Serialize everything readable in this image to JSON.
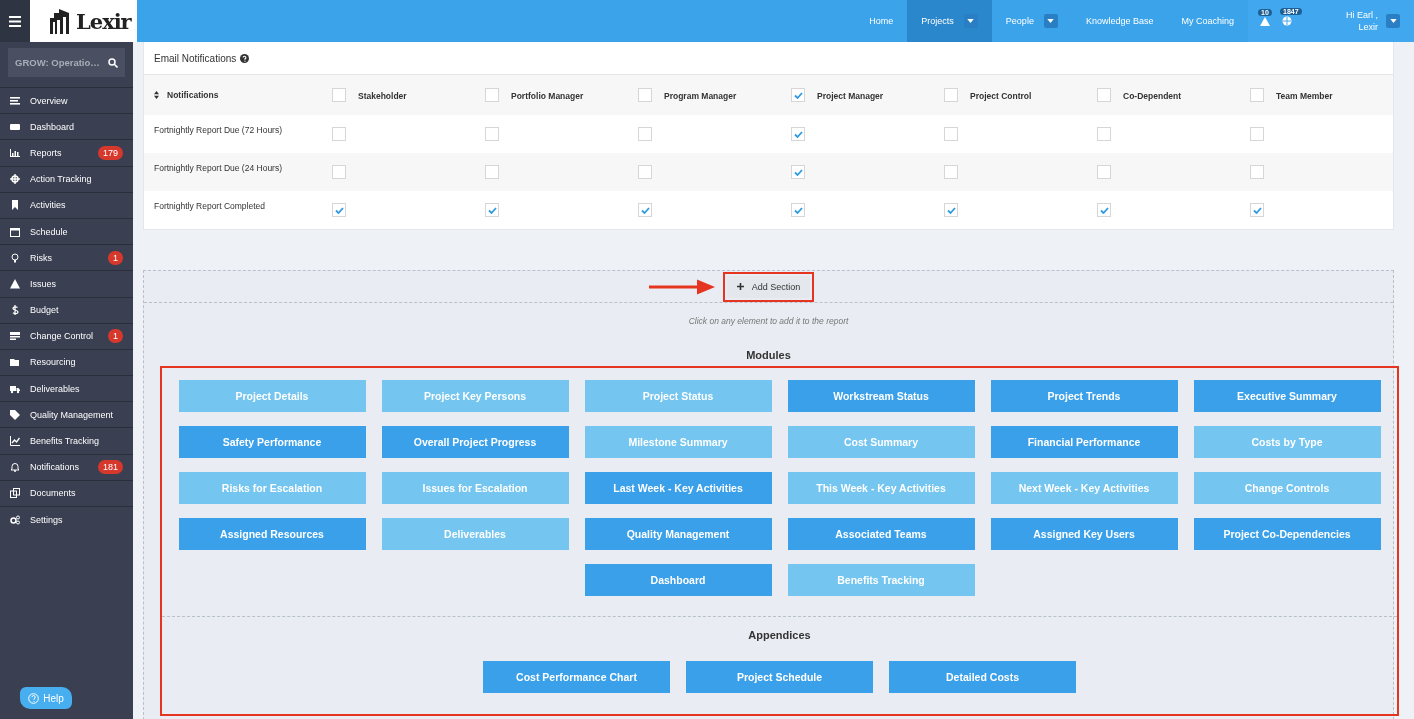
{
  "topbar": {
    "logo": "Lexir",
    "nav": [
      {
        "label": "Home",
        "selected": false,
        "dropdown": false
      },
      {
        "label": "Projects",
        "selected": true,
        "dropdown": true
      },
      {
        "label": "People",
        "selected": false,
        "dropdown": true
      },
      {
        "label": "Knowledge Base",
        "selected": false,
        "dropdown": false
      },
      {
        "label": "My Coaching",
        "selected": false,
        "dropdown": false
      }
    ],
    "alerts": [
      {
        "kind": "warning",
        "count": "10"
      },
      {
        "kind": "globe",
        "count": "1847"
      }
    ],
    "user": {
      "greeting": "Hi Earl ,",
      "name": "Lexir"
    }
  },
  "sidebar": {
    "project_search": {
      "value": "GROW: Operatio…"
    },
    "items": [
      {
        "label": "Overview"
      },
      {
        "label": "Dashboard"
      },
      {
        "label": "Reports",
        "badge": "179"
      },
      {
        "label": "Action Tracking"
      },
      {
        "label": "Activities"
      },
      {
        "label": "Schedule"
      },
      {
        "label": "Risks",
        "badge": "1"
      },
      {
        "label": "Issues"
      },
      {
        "label": "Budget"
      },
      {
        "label": "Change Control",
        "badge": "1"
      },
      {
        "label": "Resourcing"
      },
      {
        "label": "Deliverables"
      },
      {
        "label": "Quality Management"
      },
      {
        "label": "Benefits Tracking"
      },
      {
        "label": "Notifications",
        "badge": "181"
      },
      {
        "label": "Documents"
      },
      {
        "label": "Settings"
      }
    ],
    "help": "Help"
  },
  "email_notifications": {
    "title": "Email Notifications",
    "first_column": "Notifications",
    "columns": [
      {
        "label": "Stakeholder",
        "checked": false
      },
      {
        "label": "Portfolio Manager",
        "checked": false
      },
      {
        "label": "Program Manager",
        "checked": false
      },
      {
        "label": "Project Manager",
        "checked": true
      },
      {
        "label": "Project Control",
        "checked": false
      },
      {
        "label": "Co-Dependent",
        "checked": false
      },
      {
        "label": "Team Member",
        "checked": false
      }
    ],
    "rows": [
      {
        "label": "Fortnightly Report Due (72 Hours)",
        "checks": [
          false,
          false,
          false,
          true,
          false,
          false,
          false
        ]
      },
      {
        "label": "Fortnightly Report Due (24 Hours)",
        "checks": [
          false,
          false,
          false,
          true,
          false,
          false,
          false
        ]
      },
      {
        "label": "Fortnightly Report Completed",
        "checks": [
          true,
          true,
          true,
          true,
          true,
          true,
          true
        ]
      }
    ]
  },
  "report_builder": {
    "add_section": "Add Section",
    "hint": "Click on any element to add it to the report",
    "modules": {
      "title": "Modules",
      "items": [
        {
          "label": "Project Details",
          "added": true
        },
        {
          "label": "Project Key Persons",
          "added": true
        },
        {
          "label": "Project Status",
          "added": true
        },
        {
          "label": "Workstream Status",
          "added": false
        },
        {
          "label": "Project Trends",
          "added": false
        },
        {
          "label": "Executive Summary",
          "added": false
        },
        {
          "label": "Safety Performance",
          "added": false
        },
        {
          "label": "Overall Project Progress",
          "added": false
        },
        {
          "label": "Milestone Summary",
          "added": true
        },
        {
          "label": "Cost Summary",
          "added": true
        },
        {
          "label": "Financial Performance",
          "added": false
        },
        {
          "label": "Costs by Type",
          "added": true
        },
        {
          "label": "Risks for Escalation",
          "added": true
        },
        {
          "label": "Issues for Escalation",
          "added": true
        },
        {
          "label": "Last Week - Key Activities",
          "added": false
        },
        {
          "label": "This Week - Key Activities",
          "added": true
        },
        {
          "label": "Next Week - Key Activities",
          "added": true
        },
        {
          "label": "Change Controls",
          "added": true
        },
        {
          "label": "Assigned Resources",
          "added": false
        },
        {
          "label": "Deliverables",
          "added": true
        },
        {
          "label": "Quality Management",
          "added": false
        },
        {
          "label": "Associated Teams",
          "added": false
        },
        {
          "label": "Assigned Key Users",
          "added": false
        },
        {
          "label": "Project Co-Dependencies",
          "added": false
        },
        {
          "label": "Dashboard",
          "added": false
        },
        {
          "label": "Benefits Tracking",
          "added": true
        }
      ]
    },
    "appendices": {
      "title": "Appendices",
      "items": [
        {
          "label": "Cost Performance Chart",
          "added": false
        },
        {
          "label": "Project Schedule",
          "added": false
        },
        {
          "label": "Detailed Costs",
          "added": false
        }
      ]
    }
  }
}
